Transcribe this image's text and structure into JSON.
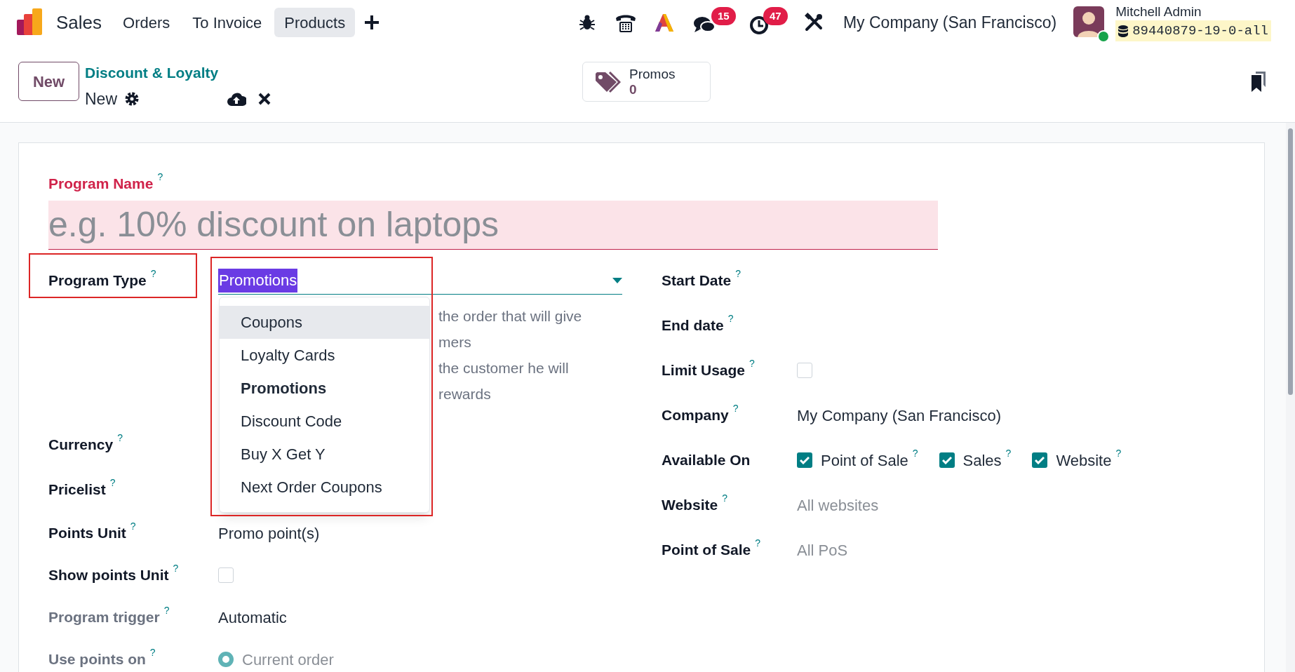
{
  "navbar": {
    "app_name": "Sales",
    "menu": [
      {
        "label": "Orders",
        "selected": false
      },
      {
        "label": "To Invoice",
        "selected": false
      },
      {
        "label": "Products",
        "selected": true
      }
    ],
    "messages_count": "15",
    "activities_count": "47",
    "company": "My Company (San Francisco)",
    "user": {
      "name": "Mitchell Admin",
      "online": true
    },
    "database": "89440879-19-0-all"
  },
  "control_panel": {
    "new_button": "New",
    "breadcrumb": "Discount & Loyalty",
    "record": "New",
    "stat_button": {
      "label": "Promos",
      "value": "0"
    }
  },
  "form": {
    "program_name": {
      "label": "Program Name",
      "help": "?",
      "placeholder": "e.g. 10% discount on laptops",
      "required": true
    },
    "program_type": {
      "label": "Program Type",
      "help": "?",
      "value": "Promotions",
      "annotated": true,
      "options": [
        {
          "label": "Coupons",
          "selected": false,
          "hovered": true
        },
        {
          "label": "Loyalty Cards",
          "selected": false,
          "hovered": false
        },
        {
          "label": "Promotions",
          "selected": true,
          "hovered": false
        },
        {
          "label": "Discount Code",
          "selected": false,
          "hovered": false
        },
        {
          "label": "Buy X Get Y",
          "selected": false,
          "hovered": false
        },
        {
          "label": "Next Order Coupons",
          "selected": false,
          "hovered": false
        }
      ]
    },
    "description": [
      "the order that will give",
      "mers",
      "the customer he will",
      "rewards"
    ],
    "left_fields": [
      {
        "label": "Currency",
        "help": "?",
        "muted": false,
        "kind": "empty"
      },
      {
        "label": "Pricelist",
        "help": "?",
        "muted": false,
        "kind": "empty"
      },
      {
        "label": "Points Unit",
        "help": "?",
        "muted": false,
        "kind": "field",
        "value": "Promo point(s)"
      },
      {
        "label": "Show points Unit",
        "help": "?",
        "muted": false,
        "kind": "checkbox",
        "checked": false
      },
      {
        "label": "Program trigger",
        "help": "?",
        "muted": true,
        "kind": "field",
        "value": "Automatic"
      },
      {
        "label": "Use points on",
        "help": "?",
        "muted": true,
        "kind": "radio",
        "value": "Current order",
        "checked": true,
        "disabled": true
      }
    ],
    "right_fields": [
      {
        "label": "Start Date",
        "help": "?",
        "muted": false,
        "kind": "empty"
      },
      {
        "label": "End date",
        "help": "?",
        "muted": false,
        "kind": "empty"
      },
      {
        "label": "Limit Usage",
        "help": "?",
        "muted": false,
        "kind": "checkbox",
        "checked": false
      },
      {
        "label": "Company",
        "help": "?",
        "muted": false,
        "kind": "field",
        "value": "My Company (San Francisco)"
      },
      {
        "label": "Available On",
        "muted": false,
        "kind": "checkboxes",
        "options": [
          {
            "label": "Point of Sale",
            "help": "?",
            "checked": true
          },
          {
            "label": "Sales",
            "help": "?",
            "checked": true
          },
          {
            "label": "Website",
            "help": "?",
            "checked": true
          }
        ]
      },
      {
        "label": "Website",
        "help": "?",
        "muted": false,
        "kind": "field",
        "placeholder": "All websites"
      },
      {
        "label": "Point of Sale",
        "help": "?",
        "muted": false,
        "kind": "field",
        "placeholder": "All PoS"
      }
    ]
  }
}
